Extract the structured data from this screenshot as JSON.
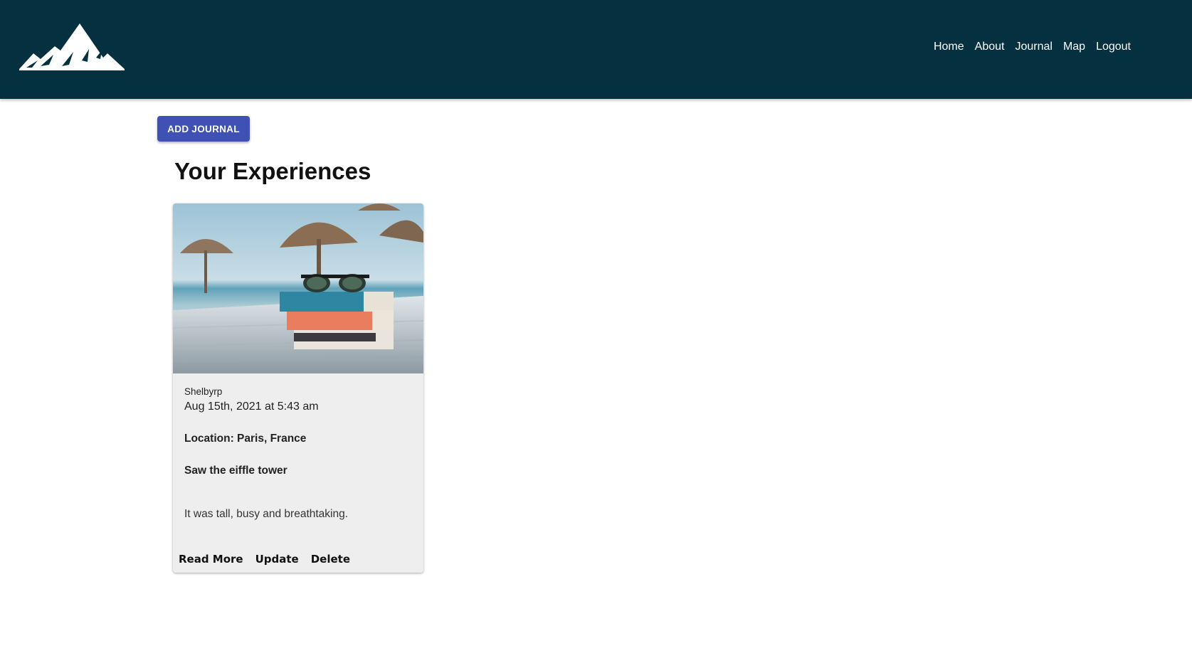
{
  "header": {
    "logo_icon": "mountain-logo-icon",
    "background_color": "#04303f",
    "nav": [
      {
        "label": "Home"
      },
      {
        "label": "About"
      },
      {
        "label": "Journal"
      },
      {
        "label": "Map"
      },
      {
        "label": "Logout"
      }
    ]
  },
  "main": {
    "add_button_label": "ADD JOURNAL",
    "add_button_color": "#3f51b5",
    "title": "Your Experiences"
  },
  "card": {
    "image_icon": "beach-books-sunglasses-image",
    "author": "Shelbyrp",
    "date": "Aug 15th, 2021 at 5:43 am",
    "location": "Location: Paris, France",
    "heading": "Saw the eiffle tower",
    "body": "It was tall, busy and breathtaking.",
    "actions": {
      "read_more": "Read More",
      "update": "Update",
      "delete": "Delete"
    }
  }
}
